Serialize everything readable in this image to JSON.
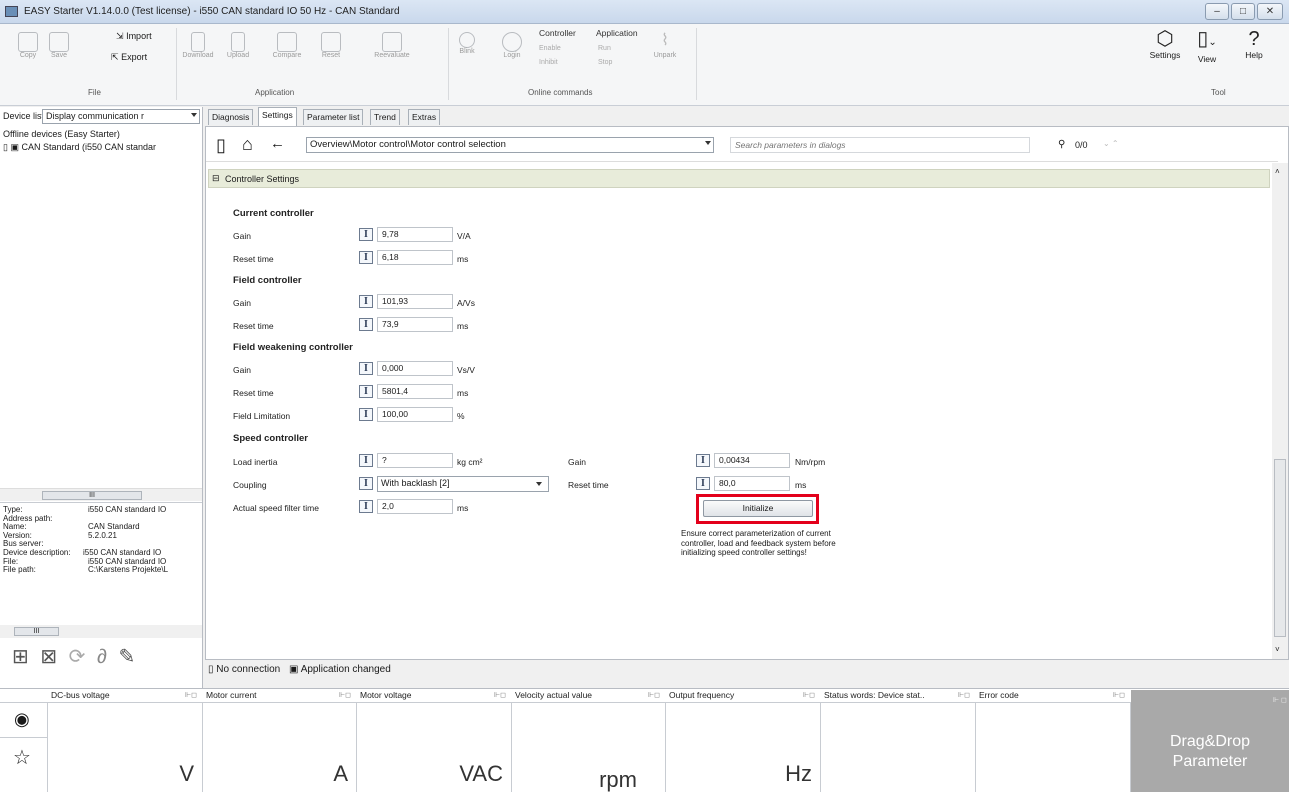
{
  "window": {
    "title": "EASY Starter V1.14.0.0 (Test license) - i550 CAN standard IO 50 Hz - CAN Standard",
    "min": "–",
    "max": "□",
    "close": "✕"
  },
  "ribbon": {
    "file": {
      "copy": "Copy",
      "save": "Save",
      "import": "Import",
      "export": "Export",
      "group": "File"
    },
    "application": {
      "download": "Download",
      "upload": "Upload",
      "compare": "Compare",
      "restart": "Reset",
      "reevaluate": "Reevaluate",
      "group": "Application"
    },
    "online": {
      "blink": "Blink",
      "login": "Login",
      "controller_header": "Controller",
      "application_header": "Application",
      "enable": "Enable",
      "inhibit": "Inhibit",
      "run": "Run",
      "stop": "Stop",
      "unpark": "Unpark",
      "group": "Online commands"
    },
    "tool": {
      "settings": "Settings",
      "view": "View",
      "help": "Help",
      "group": "Tool"
    }
  },
  "left": {
    "device_list_label": "Device list",
    "display_combo": "Display communication r",
    "tree_root": "Offline devices (Easy Starter)",
    "tree_item": "CAN Standard (i550 CAN standar",
    "props": [
      {
        "k": "Type:",
        "v": "i550 CAN standard IO"
      },
      {
        "k": "Address path:",
        "v": ""
      },
      {
        "k": "Name:",
        "v": "CAN Standard"
      },
      {
        "k": "Version:",
        "v": "5.2.0.21"
      },
      {
        "k": "Bus server:",
        "v": ""
      },
      {
        "k": "Device description:",
        "v": "i550 CAN standard IO"
      },
      {
        "k": "File:",
        "v": "i550 CAN standard IO"
      },
      {
        "k": "File path:",
        "v": "C:\\Karstens Projekte\\L"
      }
    ],
    "scroll_grip": "III"
  },
  "tabs": [
    "Diagnosis",
    "Settings",
    "Parameter list",
    "Trend",
    "Extras"
  ],
  "nav": {
    "breadcrumb": "Overview\\Motor control\\Motor control selection",
    "search_placeholder": "Search parameters in dialogs",
    "search_count": "0/0"
  },
  "section": "Controller Settings",
  "current_controller": {
    "title": "Current controller",
    "gain": {
      "label": "Gain",
      "value": "9,78",
      "unit": "V/A"
    },
    "reset": {
      "label": "Reset time",
      "value": "6,18",
      "unit": "ms"
    }
  },
  "field_controller": {
    "title": "Field controller",
    "gain": {
      "label": "Gain",
      "value": "101,93",
      "unit": "A/Vs"
    },
    "reset": {
      "label": "Reset time",
      "value": "73,9",
      "unit": "ms"
    }
  },
  "field_weakening": {
    "title": "Field weakening controller",
    "gain": {
      "label": "Gain",
      "value": "0,000",
      "unit": "Vs/V"
    },
    "reset": {
      "label": "Reset time",
      "value": "5801,4",
      "unit": "ms"
    },
    "limitation": {
      "label": "Field Limitation",
      "value": "100,00",
      "unit": "%"
    }
  },
  "speed_controller": {
    "title": "Speed controller",
    "inertia": {
      "label": "Load inertia",
      "value": "?",
      "unit": "kg cm²"
    },
    "coupling": {
      "label": "Coupling",
      "value": "With backlash [2]"
    },
    "filter": {
      "label": "Actual speed filter time",
      "value": "2,0",
      "unit": "ms"
    },
    "gain": {
      "label": "Gain",
      "value": "0,00434",
      "unit": "Nm/rpm"
    },
    "reset": {
      "label": "Reset time",
      "value": "80,0",
      "unit": "ms"
    },
    "initialize": "Initialize",
    "note": [
      "Ensure correct parameterization of current",
      "controller, load and feedback system before",
      "initializing speed controller settings!"
    ],
    "ibox": "I"
  },
  "status": {
    "connection": "No connection",
    "app": "Application changed"
  },
  "monitor": [
    {
      "label": "DC-bus voltage",
      "unit": "V"
    },
    {
      "label": "Motor current",
      "unit": "A"
    },
    {
      "label": "Motor voltage",
      "unit": "VAC"
    },
    {
      "label": "Velocity actual value",
      "unit": "rpm"
    },
    {
      "label": "Output frequency",
      "unit": "Hz"
    },
    {
      "label": "Status words: Device stat..",
      "unit": ""
    },
    {
      "label": "Error code",
      "unit": ""
    }
  ],
  "dragdrop": [
    "Drag&Drop",
    "Parameter"
  ],
  "colors": {
    "highlight": "#e3001b",
    "section_bar": "#e8ecda",
    "dragdrop_bg": "#a9a9a9"
  }
}
